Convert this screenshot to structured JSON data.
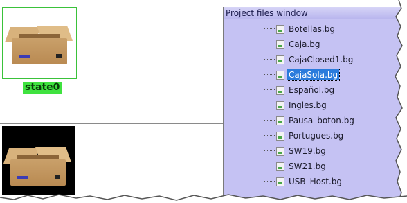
{
  "state_editor": {
    "state_label": "state0"
  },
  "project_window": {
    "title": "Project files window",
    "files": [
      {
        "name": "Botellas.bg",
        "selected": false
      },
      {
        "name": "Caja.bg",
        "selected": false
      },
      {
        "name": "CajaClosed1.bg",
        "selected": false
      },
      {
        "name": "CajaSola.bg",
        "selected": true
      },
      {
        "name": "Español.bg",
        "selected": false
      },
      {
        "name": "Ingles.bg",
        "selected": false
      },
      {
        "name": "Pausa_boton.bg",
        "selected": false
      },
      {
        "name": "Portugues.bg",
        "selected": false
      },
      {
        "name": "SW19.bg",
        "selected": false
      },
      {
        "name": "SW21.bg",
        "selected": false
      },
      {
        "name": "USB_Host.bg",
        "selected": false
      }
    ],
    "icon": "file-image-icon"
  },
  "colors": {
    "window_bg": "#c5c2f3",
    "selection": "#2a7bdc",
    "state_label_bg": "#3fe23f",
    "state_frame_border": "#3ac23a"
  }
}
